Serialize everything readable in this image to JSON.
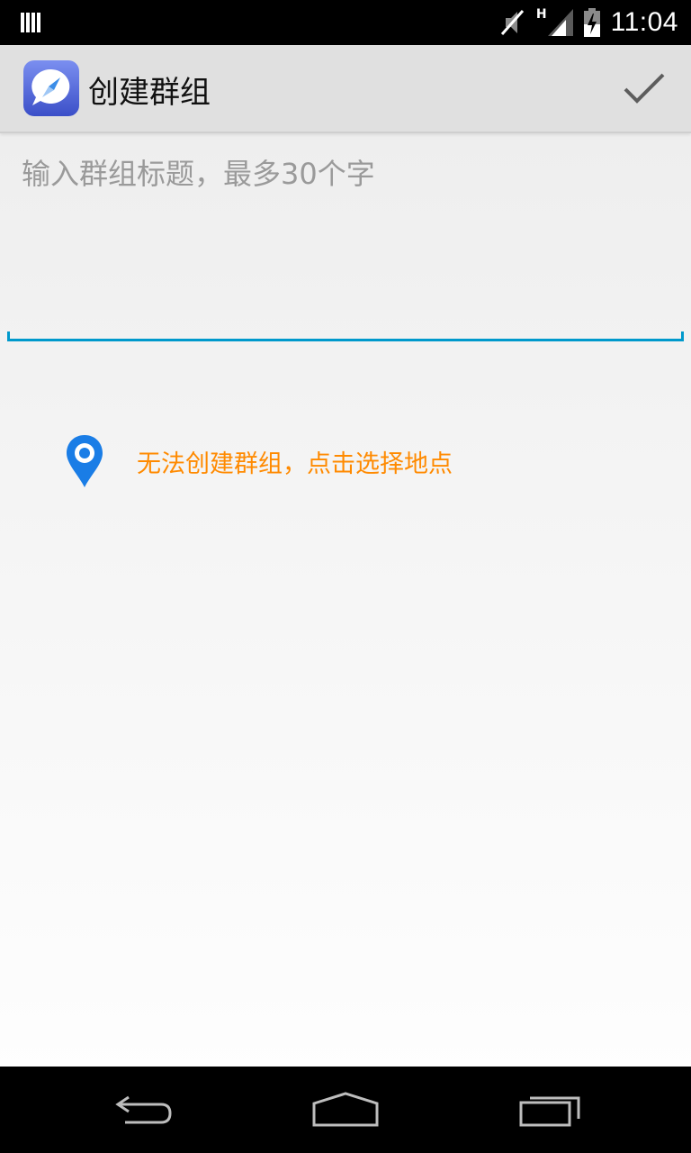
{
  "status_bar": {
    "clock": "11:04",
    "network": "H",
    "icons": [
      "notification-icon",
      "mute-icon",
      "signal-icon",
      "battery-icon"
    ]
  },
  "action_bar": {
    "title": "创建群组",
    "logo_icon": "compass-chat-icon",
    "confirm_icon": "check-icon"
  },
  "title_input": {
    "value": "",
    "placeholder": "输入群组标题，最多30个字"
  },
  "location": {
    "icon": "map-pin-icon",
    "text": "无法创建群组，点击选择地点"
  },
  "nav_bar": {
    "icons": [
      "back-icon",
      "home-icon",
      "recents-icon"
    ]
  },
  "colors": {
    "accent": "#0099cc",
    "warning_text": "#ff8a00",
    "pin": "#1a7de6"
  }
}
